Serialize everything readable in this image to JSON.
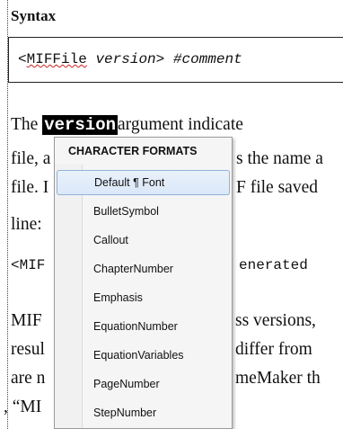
{
  "doc": {
    "heading": "Syntax",
    "syntax": {
      "open": "<",
      "keyword": "MIFFile",
      "arg": "version>",
      "comment": "#comment"
    },
    "para1": {
      "prefix": "The ",
      "highlight": "version",
      "rest": "argument indicate"
    },
    "lines_left": [
      "file, a",
      "file. I",
      "line:"
    ],
    "lines_right": [
      "s the name a",
      "F file saved"
    ],
    "mono_line": {
      "left": "<MIF",
      "right": "enerated"
    },
    "para2_left": [
      "MIF",
      "resul",
      "are n",
      ", “MI"
    ],
    "para2_right": [
      "ss versions,",
      " differ from",
      "meMaker th"
    ]
  },
  "menu": {
    "title": "CHARACTER FORMATS",
    "selected_index": 0,
    "items": [
      "Default ¶ Font",
      "BulletSymbol",
      "Callout",
      "ChapterNumber",
      "Emphasis",
      "EquationNumber",
      "EquationVariables",
      "PageNumber",
      "StepNumber"
    ]
  }
}
